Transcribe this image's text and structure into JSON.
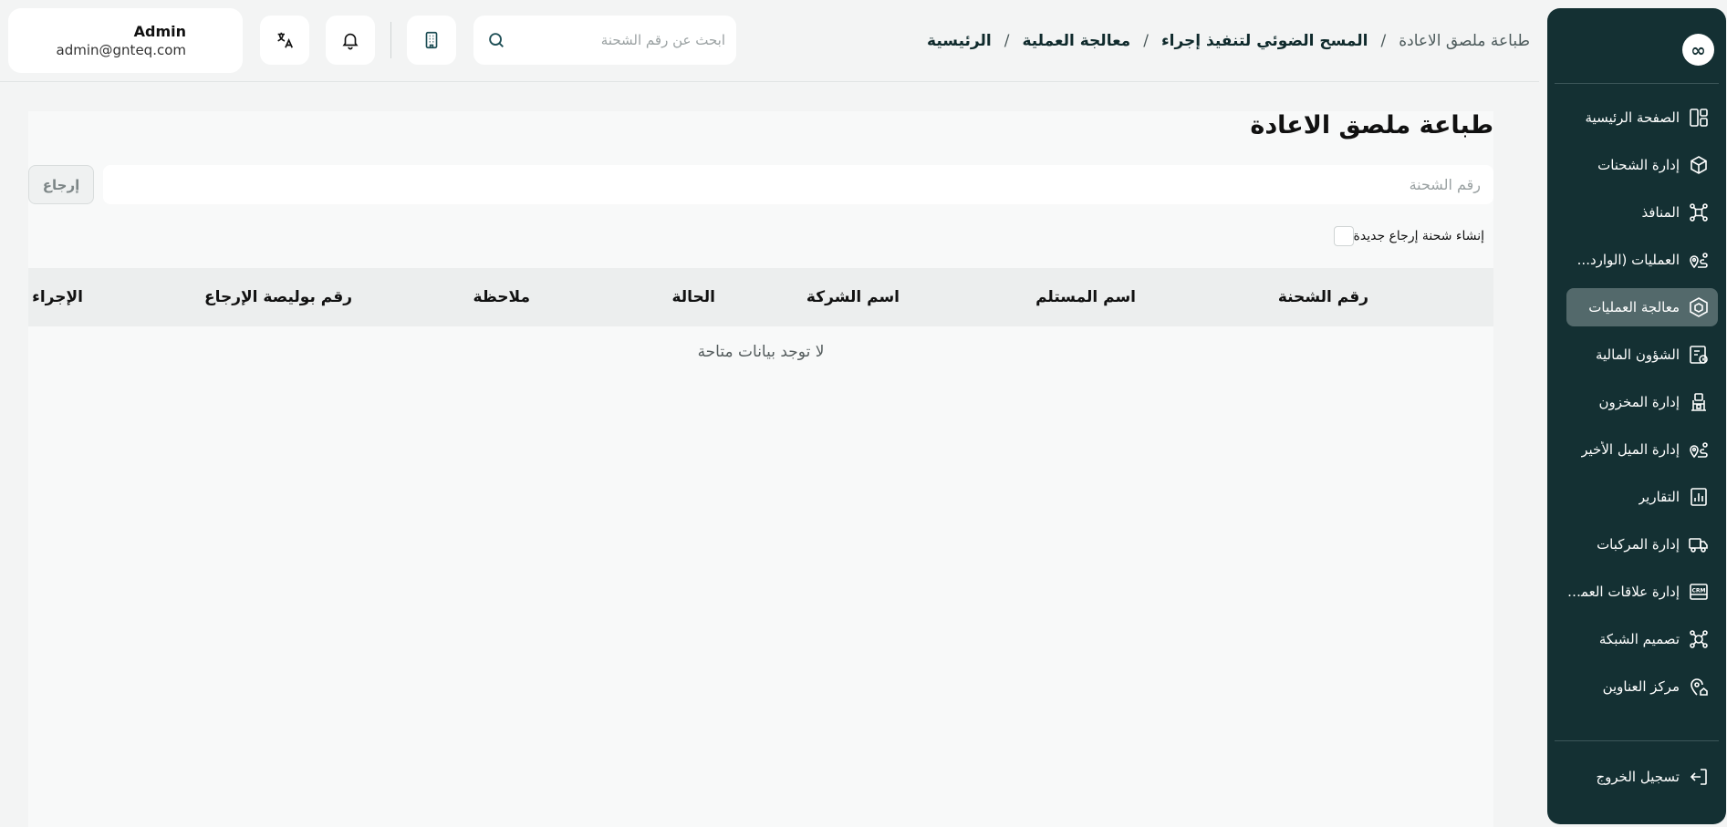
{
  "sidebar": {
    "logo_symbol": "∞",
    "items": [
      {
        "label": "الصفحة الرئيسية",
        "icon": "dashboard-icon"
      },
      {
        "label": "إدارة الشحنات",
        "icon": "package-icon"
      },
      {
        "label": "المنافذ",
        "icon": "network-icon"
      },
      {
        "label": "العمليات (الوارد...",
        "icon": "route-pin-icon"
      },
      {
        "label": "معالجة العمليات",
        "icon": "box-process-icon",
        "active": true
      },
      {
        "label": "الشؤون المالية",
        "icon": "finance-icon"
      },
      {
        "label": "إدارة المخزون",
        "icon": "warehouse-icon"
      },
      {
        "label": "إدارة الميل الأخير",
        "icon": "route-pin-icon"
      },
      {
        "label": "التقارير",
        "icon": "report-icon"
      },
      {
        "label": "إدارة المركبات",
        "icon": "truck-icon"
      },
      {
        "label": "إدارة علاقات العملاء",
        "icon": "crm-icon"
      },
      {
        "label": "تصميم الشبكة",
        "icon": "network-icon"
      },
      {
        "label": "مركز العناوين",
        "icon": "address-icon"
      }
    ],
    "logout_label": "تسجيل الخروج"
  },
  "header": {
    "breadcrumb": [
      {
        "label": "الرئيسية"
      },
      {
        "label": "معالجة العملية"
      },
      {
        "label": "المسح الضوئي لتنفيذ إجراء"
      },
      {
        "label": "طباعة ملصق الاعادة",
        "current": true
      }
    ],
    "separator": "/",
    "search_placeholder": "ابحث عن رقم الشحنة",
    "user": {
      "name": "Admin",
      "email": "admin@gnteq.com"
    }
  },
  "main": {
    "title": "طباعة ملصق الاعادة",
    "shipment_input_placeholder": "رقم الشحنة",
    "return_button": "إرجاع",
    "create_return_label": "إنشاء شحنة إرجاع جديدة",
    "columns": [
      "رقم الشحنة",
      "اسم المستلم",
      "اسم الشركة",
      "الحالة",
      "ملاحظة",
      "رقم بوليصة الإرجاع",
      "الإجراء"
    ],
    "empty_message": "لا توجد بيانات متاحة"
  },
  "colors": {
    "sidebar_bg": "#143033",
    "sidebar_active": "#53696b",
    "accent": "#0f2a2c",
    "page_bg": "#f3f4f4"
  }
}
